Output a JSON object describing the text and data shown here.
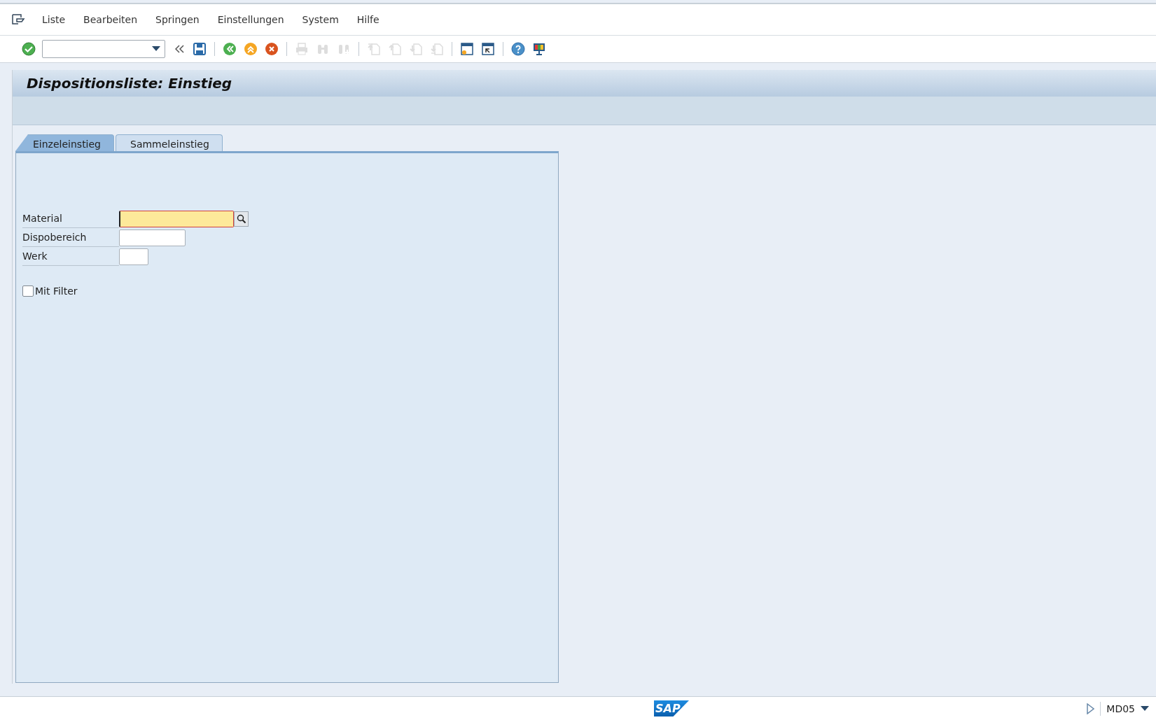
{
  "menu": [
    "Liste",
    "Bearbeiten",
    "Springen",
    "Einstellungen",
    "System",
    "Hilfe"
  ],
  "toolbar": [
    {
      "kind": "enter",
      "disabled": false
    },
    {
      "kind": "command"
    },
    {
      "kind": "collapse"
    },
    {
      "kind": "save",
      "disabled": false
    },
    {
      "kind": "sep"
    },
    {
      "kind": "back",
      "disabled": false
    },
    {
      "kind": "exit",
      "disabled": false
    },
    {
      "kind": "cancel",
      "disabled": false
    },
    {
      "kind": "sep"
    },
    {
      "kind": "print",
      "disabled": true
    },
    {
      "kind": "find",
      "disabled": true
    },
    {
      "kind": "findnext",
      "disabled": true
    },
    {
      "kind": "sep"
    },
    {
      "kind": "first",
      "disabled": true
    },
    {
      "kind": "prev",
      "disabled": true
    },
    {
      "kind": "next",
      "disabled": true
    },
    {
      "kind": "last",
      "disabled": true
    },
    {
      "kind": "sep"
    },
    {
      "kind": "newsession",
      "disabled": false
    },
    {
      "kind": "shortcut",
      "disabled": false
    },
    {
      "kind": "sep"
    },
    {
      "kind": "help",
      "disabled": false
    },
    {
      "kind": "layout",
      "disabled": false
    }
  ],
  "title": "Dispositionsliste: Einstieg",
  "tabs": [
    {
      "label": "Einzeleinstieg",
      "selected": true
    },
    {
      "label": "Sammeleinstieg",
      "selected": false
    }
  ],
  "fields": [
    {
      "label": "Material",
      "focused": true,
      "search_help": true
    },
    {
      "label": "Dispobereich",
      "focused": false,
      "search_help": false
    },
    {
      "label": "Werk",
      "focused": false,
      "search_help": false
    }
  ],
  "checkbox": {
    "label": "Mit Filter",
    "checked": false
  },
  "status_bar": {
    "logo": "SAP",
    "transaction": "MD05"
  }
}
